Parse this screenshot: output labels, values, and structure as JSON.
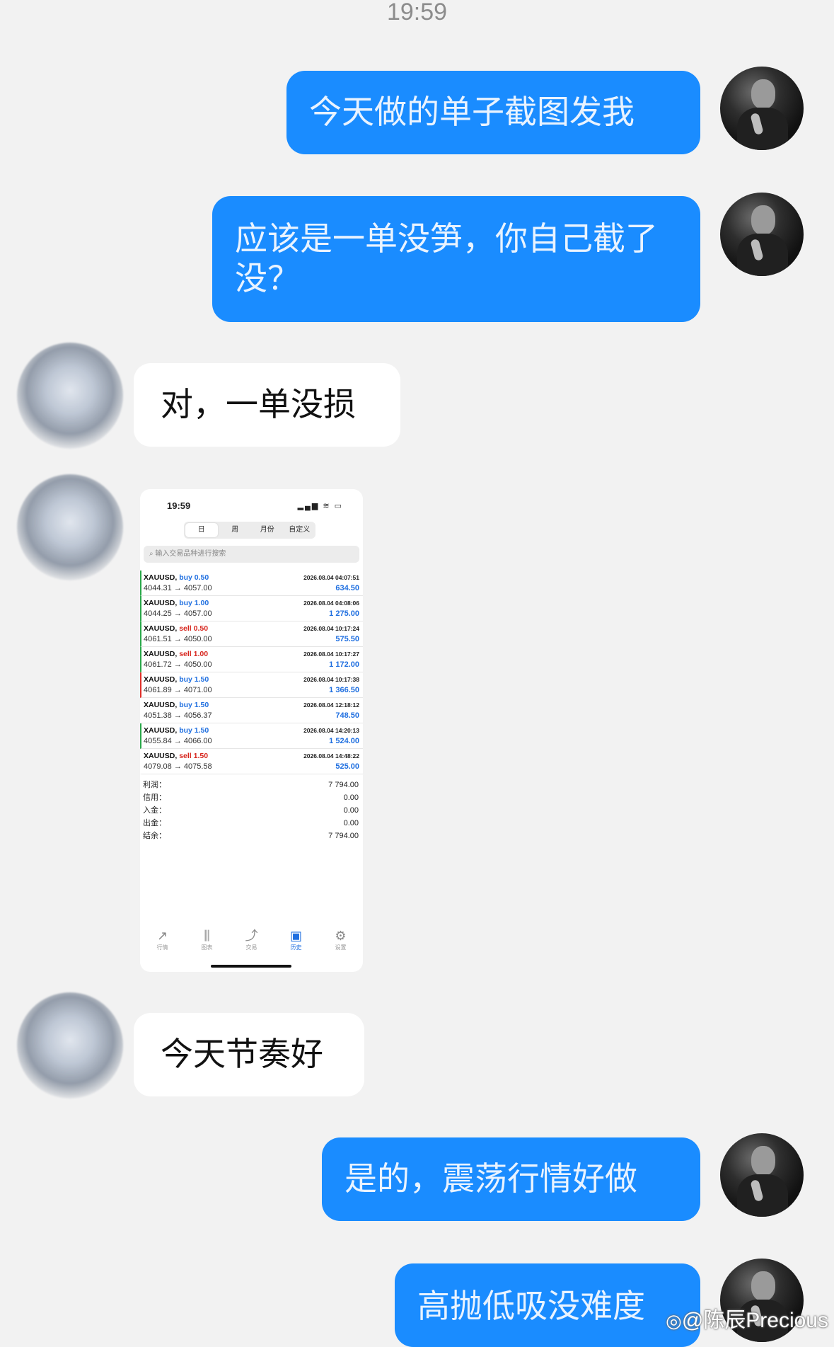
{
  "status_time": "19:59",
  "messages": [
    {
      "direction": "out",
      "text": "今天做的单子截图发我"
    },
    {
      "direction": "out",
      "text": "应该是一单没笋，你自己截了没？"
    },
    {
      "direction": "in",
      "text": "对，一单没损"
    },
    {
      "direction": "in",
      "type": "image"
    },
    {
      "direction": "in",
      "text": "今天节奏好"
    },
    {
      "direction": "out",
      "text": "是的，震荡行情好做"
    },
    {
      "direction": "out",
      "text": "高抛低吸没难度"
    }
  ],
  "screenshot": {
    "time": "19:59",
    "status_icons": "▂▄▆ ≋ ▭",
    "segments": [
      "日",
      "周",
      "月份",
      "自定义"
    ],
    "active_segment": "日",
    "search_placeholder": "输入交易品种进行搜索",
    "trades": [
      {
        "symbol": "XAUUSD,",
        "side": "buy",
        "lots": "0.50",
        "open": "4044.31",
        "close": "4057.00",
        "time": "2026.08.04 04:07:51",
        "profit": "634.50",
        "bar": "green"
      },
      {
        "symbol": "XAUUSD,",
        "side": "buy",
        "lots": "1.00",
        "open": "4044.25",
        "close": "4057.00",
        "time": "2026.08.04 04:08:06",
        "profit": "1 275.00",
        "bar": "green"
      },
      {
        "symbol": "XAUUSD,",
        "side": "sell",
        "lots": "0.50",
        "open": "4061.51",
        "close": "4050.00",
        "time": "2026.08.04 10:17:24",
        "profit": "575.50",
        "bar": "green"
      },
      {
        "symbol": "XAUUSD,",
        "side": "sell",
        "lots": "1.00",
        "open": "4061.72",
        "close": "4050.00",
        "time": "2026.08.04 10:17:27",
        "profit": "1 172.00",
        "bar": "green"
      },
      {
        "symbol": "XAUUSD,",
        "side": "buy",
        "lots": "1.50",
        "open": "4061.89",
        "close": "4071.00",
        "time": "2026.08.04 10:17:38",
        "profit": "1 366.50",
        "bar": "red"
      },
      {
        "symbol": "XAUUSD,",
        "side": "buy",
        "lots": "1.50",
        "open": "4051.38",
        "close": "4056.37",
        "time": "2026.08.04 12:18:12",
        "profit": "748.50",
        "bar": "none"
      },
      {
        "symbol": "XAUUSD,",
        "side": "buy",
        "lots": "1.50",
        "open": "4055.84",
        "close": "4066.00",
        "time": "2026.08.04 14:20:13",
        "profit": "1 524.00",
        "bar": "green"
      },
      {
        "symbol": "XAUUSD,",
        "side": "sell",
        "lots": "1.50",
        "open": "4079.08",
        "close": "4075.58",
        "time": "2026.08.04 14:48:22",
        "profit": "525.00",
        "bar": "none"
      }
    ],
    "arrow": "→",
    "summary": [
      {
        "label": "利润：",
        "value": "7 794.00"
      },
      {
        "label": "信用：",
        "value": "0.00"
      },
      {
        "label": "入金：",
        "value": "0.00"
      },
      {
        "label": "出金：",
        "value": "0.00"
      },
      {
        "label": "结余：",
        "value": "7 794.00"
      }
    ],
    "tabs": [
      {
        "label": "行情",
        "icon": "↗"
      },
      {
        "label": "图表",
        "icon": "⫼"
      },
      {
        "label": "交易",
        "icon": "⤴"
      },
      {
        "label": "历史",
        "icon": "▣",
        "active": true
      },
      {
        "label": "设置",
        "icon": "⚙"
      }
    ]
  },
  "watermark": {
    "icon": "weibo-icon",
    "text": "@陈辰Precious"
  }
}
